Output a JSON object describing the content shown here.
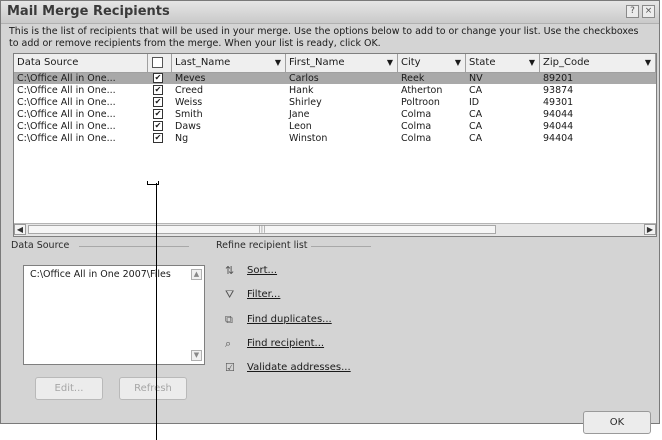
{
  "window": {
    "title": "Mail Merge Recipients",
    "help_button": "?",
    "close_button": "×"
  },
  "description": "This is the list of recipients that will be used in your merge.  Use the options below to add to or change your list.  Use the checkboxes to add or remove recipients from the merge.  When your list is ready, click OK.",
  "table": {
    "columns": [
      "Data Source",
      "",
      "Last_Name",
      "First_Name",
      "City",
      "State",
      "Zip_Code"
    ],
    "rows": [
      {
        "source": "C:\\Office All in One...",
        "checked": "✔",
        "last": "Meves",
        "first": "Carlos",
        "city": "Reek",
        "state": "NV",
        "zip": "89201",
        "selected": true
      },
      {
        "source": "C:\\Office All in One...",
        "checked": "✔",
        "last": "Creed",
        "first": "Hank",
        "city": "Atherton",
        "state": "CA",
        "zip": "93874",
        "selected": false
      },
      {
        "source": "C:\\Office All in One...",
        "checked": "✔",
        "last": "Weiss",
        "first": "Shirley",
        "city": "Poltroon",
        "state": "ID",
        "zip": "49301",
        "selected": false
      },
      {
        "source": "C:\\Office All in One...",
        "checked": "✔",
        "last": "Smith",
        "first": "Jane",
        "city": "Colma",
        "state": "CA",
        "zip": "94044",
        "selected": false
      },
      {
        "source": "C:\\Office All in One...",
        "checked": "✔",
        "last": "Daws",
        "first": "Leon",
        "city": "Colma",
        "state": "CA",
        "zip": "94044",
        "selected": false
      },
      {
        "source": "C:\\Office All in One...",
        "checked": "✔",
        "last": "Ng",
        "first": "Winston",
        "city": "Colma",
        "state": "CA",
        "zip": "94404",
        "selected": false
      }
    ],
    "scroll_grip": "|||"
  },
  "data_source": {
    "label": "Data Source",
    "item": "C:\\Office All in One 2007\\Files",
    "edit_label": "Edit...",
    "refresh_label": "Refresh"
  },
  "refine": {
    "label": "Refine recipient list",
    "items": [
      {
        "label": "Sort...",
        "icon": "sort-icon"
      },
      {
        "label": "Filter...",
        "icon": "filter-icon"
      },
      {
        "label": "Find duplicates...",
        "icon": "find-duplicates-icon"
      },
      {
        "label": "Find recipient...",
        "icon": "find-recipient-icon"
      },
      {
        "label": "Validate addresses...",
        "icon": "validate-addresses-icon"
      }
    ]
  },
  "ok_label": "OK"
}
